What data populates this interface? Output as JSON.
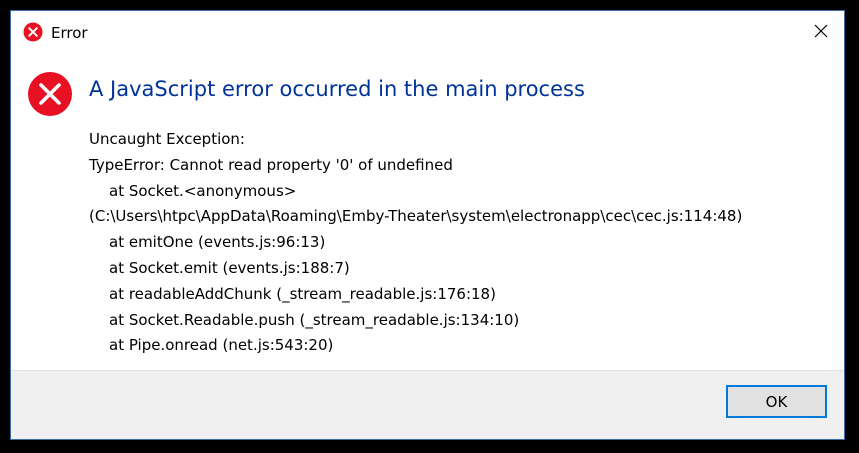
{
  "window": {
    "title": "Error",
    "title_icon": "error-icon",
    "close_icon": "close-icon"
  },
  "dialog": {
    "icon": "error-icon",
    "heading": "A JavaScript error occurred in the main process",
    "message_lines": [
      {
        "text": "Uncaught Exception:",
        "indent": false
      },
      {
        "text": "TypeError: Cannot read property '0' of undefined",
        "indent": false
      },
      {
        "text": "at Socket.<anonymous>",
        "indent": true
      },
      {
        "text": "(C:\\Users\\htpc\\AppData\\Roaming\\Emby-Theater\\system\\electronapp\\cec\\cec.js:114:48)",
        "indent": false
      },
      {
        "text": "at emitOne (events.js:96:13)",
        "indent": true
      },
      {
        "text": "at Socket.emit (events.js:188:7)",
        "indent": true
      },
      {
        "text": "at readableAddChunk (_stream_readable.js:176:18)",
        "indent": true
      },
      {
        "text": "at Socket.Readable.push (_stream_readable.js:134:10)",
        "indent": true
      },
      {
        "text": "at Pipe.onread (net.js:543:20)",
        "indent": true
      }
    ]
  },
  "footer": {
    "ok_label": "OK"
  },
  "colors": {
    "heading": "#003399",
    "error_red": "#e81123",
    "button_focus": "#0078d7",
    "footer_bg": "#f0f0f0"
  }
}
